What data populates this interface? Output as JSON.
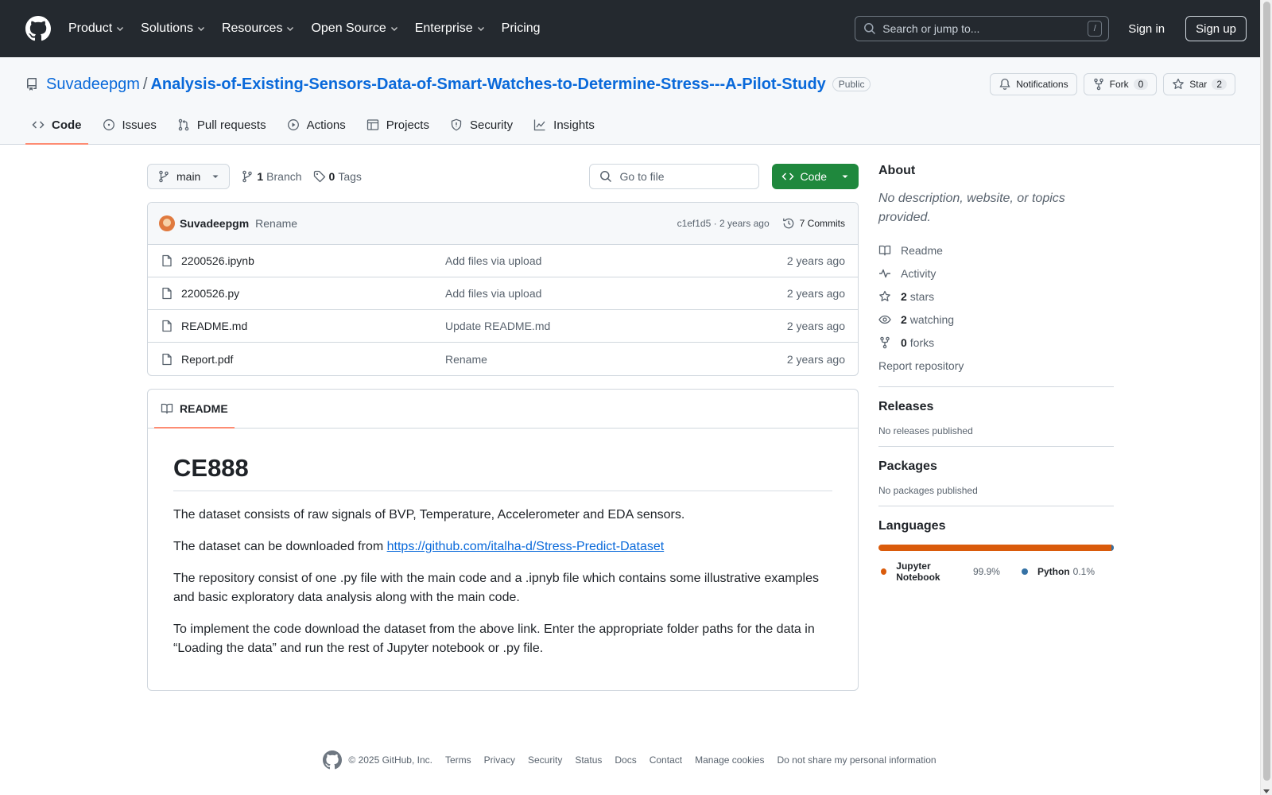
{
  "header": {
    "nav": [
      "Product",
      "Solutions",
      "Resources",
      "Open Source",
      "Enterprise",
      "Pricing"
    ],
    "search_placeholder": "Search or jump to...",
    "search_shortcut": "/",
    "sign_in": "Sign in",
    "sign_up": "Sign up"
  },
  "repo": {
    "owner": "Suvadeepgm",
    "separator": "/",
    "name": "Analysis-of-Existing-Sensors-Data-of-Smart-Watches-to-Determine-Stress---A-Pilot-Study",
    "visibility": "Public",
    "notifications_label": "Notifications",
    "fork_label": "Fork",
    "fork_count": "0",
    "star_label": "Star",
    "star_count": "2"
  },
  "tabs": [
    "Code",
    "Issues",
    "Pull requests",
    "Actions",
    "Projects",
    "Security",
    "Insights"
  ],
  "file_nav": {
    "branch": "main",
    "branch_count": "1",
    "branch_label": "Branch",
    "tag_count": "0",
    "tag_label": "Tags",
    "goto_placeholder": "Go to file",
    "code_button": "Code"
  },
  "latest_commit": {
    "author": "Suvadeepgm",
    "message": "Rename",
    "hash_time": "c1ef1d5 · 2 years ago",
    "commits": "7 Commits"
  },
  "files": [
    {
      "name": "2200526.ipynb",
      "message": "Add files via upload",
      "time": "2 years ago"
    },
    {
      "name": "2200526.py",
      "message": "Add files via upload",
      "time": "2 years ago"
    },
    {
      "name": "README.md",
      "message": "Update README.md",
      "time": "2 years ago"
    },
    {
      "name": "Report.pdf",
      "message": "Rename",
      "time": "2 years ago"
    }
  ],
  "readme": {
    "tab_label": "README",
    "title": "CE888",
    "p1": "The dataset consists of raw signals of BVP, Temperature, Accelerometer and EDA sensors.",
    "p2_prefix": "The dataset can be downloaded from ",
    "p2_link": "https://github.com/italha-d/Stress-Predict-Dataset",
    "p3": "The repository consist of one .py file with the main code and a .ipnyb file which contains some illustrative examples and basic exploratory data analysis along with the main code.",
    "p4": "To implement the code download the dataset from the above link. Enter the appropriate folder paths for the data in “Loading the data” and run the rest of Jupyter notebook or .py file."
  },
  "about": {
    "heading": "About",
    "description": "No description, website, or topics provided.",
    "readme": "Readme",
    "activity": "Activity",
    "stars_count": "2",
    "stars_label": "stars",
    "watching_count": "2",
    "watching_label": "watching",
    "forks_count": "0",
    "forks_label": "forks",
    "report": "Report repository"
  },
  "releases": {
    "heading": "Releases",
    "empty": "No releases published"
  },
  "packages": {
    "heading": "Packages",
    "empty": "No packages published"
  },
  "languages": {
    "heading": "Languages",
    "items": [
      {
        "name": "Jupyter Notebook",
        "percent": "99.9%",
        "fraction": 0.999,
        "color": "#DA5B0B"
      },
      {
        "name": "Python",
        "percent": "0.1%",
        "fraction": 0.001,
        "color": "#3572A5"
      }
    ]
  },
  "footer": {
    "copyright": "© 2025 GitHub, Inc.",
    "links": [
      "Terms",
      "Privacy",
      "Security",
      "Status",
      "Docs",
      "Contact",
      "Manage cookies",
      "Do not share my personal information"
    ]
  },
  "colors": {
    "header_bg": "#24292f",
    "link": "#0969da",
    "primary_button": "#1f883d",
    "tab_underline": "#fd8c73"
  }
}
